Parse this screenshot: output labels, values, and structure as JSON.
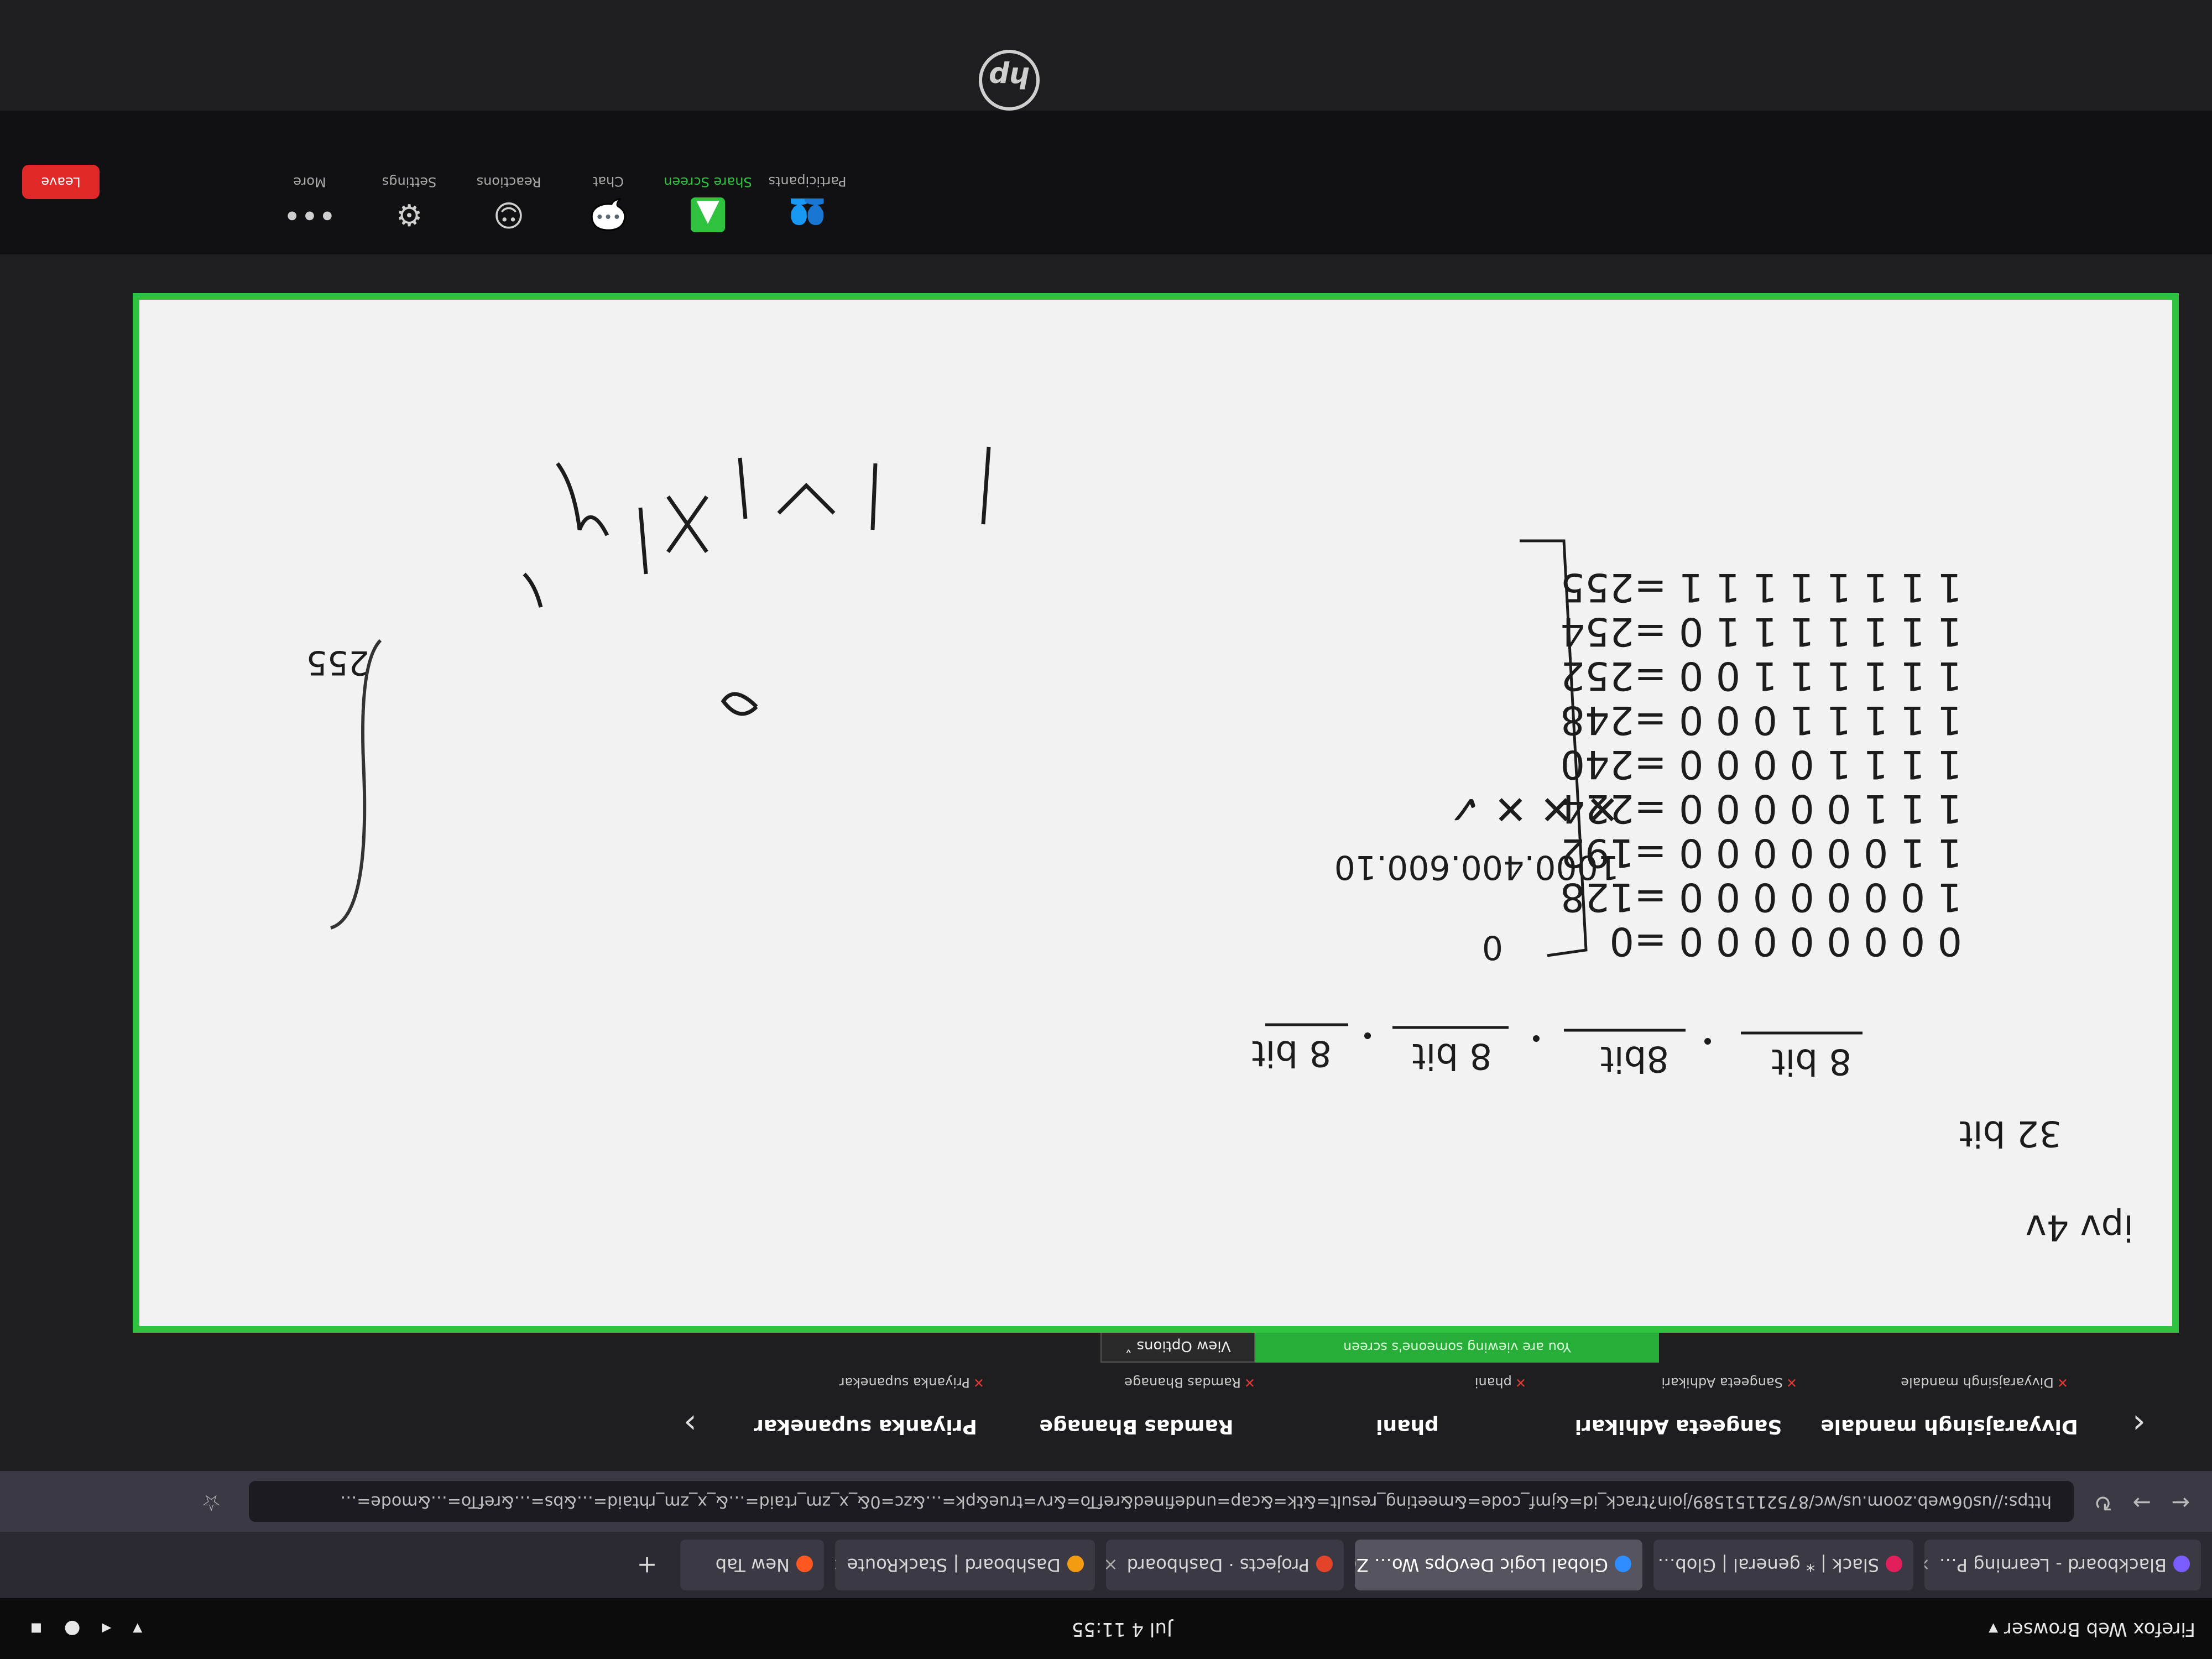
{
  "system_bar": {
    "activities": "Firefox Web Browser ▾",
    "clock": "Jul 4  11:55",
    "status_icons": "▾ ◂ ● ▪"
  },
  "tabs": [
    {
      "label": "Blackboard - Learning P…",
      "color": "#7b5cff"
    },
    {
      "label": "Slack | * general | Glob…",
      "color": "#e01e5a"
    },
    {
      "label": "Global Logic DevOps Wo… Zoom",
      "color": "#2d8cff"
    },
    {
      "label": "Projects · Dashboard",
      "color": "#e24329"
    },
    {
      "label": "Dashboard | StackRoute",
      "color": "#f39c12"
    },
    {
      "label": "New Tab",
      "color": "#ff5722"
    }
  ],
  "tab_close": "×",
  "new_tab": "+",
  "nav": {
    "back": "←",
    "forward": "→",
    "reload": "↻",
    "url": "https://us06web.zoom.us/wc/87521151589/join?track_id=&jmf_code=&meeting_result=&tk=&cap=undefined&refTo=&rv=true&pk=…&zc=0&_x_zm_rtaid=…&_x_zm_rhtaid=…&bs=…&refTo=…&mode=…",
    "star": "☆"
  },
  "gallery": {
    "prev": "‹",
    "next": "›",
    "participants": [
      {
        "big": "Divyarajsingh mandale",
        "small": "Divyarajsingh mandale"
      },
      {
        "big": "Sangeeta Adhikari",
        "small": "Sangeeta Adhikari"
      },
      {
        "big": "phani",
        "small": "phani"
      },
      {
        "big": "Ramdas Bhanage",
        "small": "Ramdas Bhanage"
      },
      {
        "big": "Priyanka supanekar",
        "small": "Priyanka supanekar"
      }
    ]
  },
  "share_banner": "You are viewing someone's screen",
  "view_options": "View Options ˅",
  "whiteboard": {
    "title": "ipv 4v",
    "bits_total": "32 bit",
    "octets": [
      "8 bit",
      "8bit",
      "8 bit",
      "8 bit"
    ],
    "binary_rows": [
      "0 0 0 0 0 0 0 0  =0",
      "1 0 0 0 0 0 0 0  =128",
      "1 1 0 0 0 0 0 0  =192",
      "1 1 1 0 0 0 0 0  =224",
      "1 1 1 1 0 0 0 0  =240",
      "1 1 1 1 1 0 0 0  =248",
      "1 1 1 1 1 1 0 0  =252",
      "1 1 1 1 1 1 1 0  =254",
      "1 1 1 1 1 1 1 1  =255"
    ],
    "range_low": "0",
    "range_high": "255",
    "example_ip": "1000.400.600.10",
    "ticks": "✕ ✕ ✕ ✓"
  },
  "toolbar": {
    "items": [
      {
        "icon": "👥",
        "label": "Participants"
      },
      {
        "icon": "▲",
        "label": "Share Screen"
      },
      {
        "icon": "💬",
        "label": "Chat"
      },
      {
        "icon": "☺",
        "label": "Reactions"
      },
      {
        "icon": "⚙",
        "label": "Settings"
      },
      {
        "icon": "•••",
        "label": "More"
      }
    ],
    "leave": "Leave"
  },
  "hp_logo": "hp"
}
